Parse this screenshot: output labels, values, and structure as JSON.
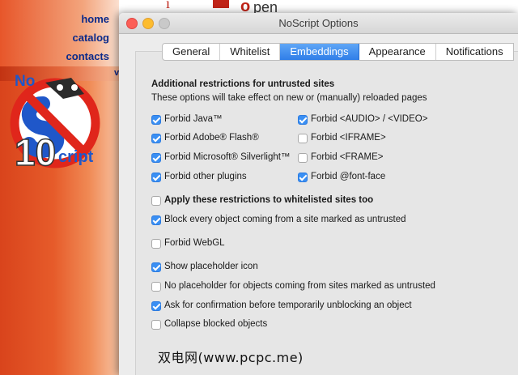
{
  "site": {
    "nav": [
      "home",
      "catalog",
      "contacts"
    ],
    "bar_mark": "v",
    "logo_text_top": "No",
    "logo_text_number": "10",
    "logo_text_bottom": "cript",
    "logo_letter": "S"
  },
  "window": {
    "title": "NoScript Options",
    "tabs": [
      {
        "label": "General",
        "active": false
      },
      {
        "label": "Whitelist",
        "active": false
      },
      {
        "label": "Embeddings",
        "active": true
      },
      {
        "label": "Appearance",
        "active": false
      },
      {
        "label": "Notifications",
        "active": false
      }
    ],
    "heading": "Additional restrictions for untrusted sites",
    "subheading": "These options will take effect on new or (manually) reloaded pages",
    "options_left": [
      {
        "label": "Forbid Java™",
        "checked": true
      },
      {
        "label": "Forbid Adobe® Flash®",
        "checked": true
      },
      {
        "label": "Forbid Microsoft® Silverlight™",
        "checked": true
      },
      {
        "label": "Forbid other plugins",
        "checked": true
      }
    ],
    "options_right": [
      {
        "label": "Forbid <AUDIO> / <VIDEO>",
        "checked": true
      },
      {
        "label": "Forbid <IFRAME>",
        "checked": false
      },
      {
        "label": "Forbid <FRAME>",
        "checked": false
      },
      {
        "label": "Forbid @font-face",
        "checked": true
      }
    ],
    "options_more": [
      {
        "label": "Apply these restrictions to whitelisted sites too",
        "checked": false,
        "bold": true
      },
      {
        "label": "Block every object coming from a site marked as untrusted",
        "checked": true,
        "bold": false
      },
      {
        "label": "Forbid WebGL",
        "checked": false,
        "bold": false
      },
      {
        "label": "Show placeholder icon",
        "checked": true,
        "bold": false
      },
      {
        "label": "No placeholder for objects coming from sites marked as untrusted",
        "checked": false,
        "bold": false
      },
      {
        "label": "Ask for confirmation before temporarily unblocking an object",
        "checked": true,
        "bold": false
      },
      {
        "label": "Collapse blocked objects",
        "checked": false,
        "bold": false
      }
    ]
  },
  "watermark": "双电网(www.pcpc.me)",
  "colors": {
    "accent": "#3a8ff3",
    "nav_link": "#0b2a8a",
    "site_orange": "#e65b2a",
    "logo_red": "#e0261b",
    "logo_blue": "#1f57c9"
  }
}
